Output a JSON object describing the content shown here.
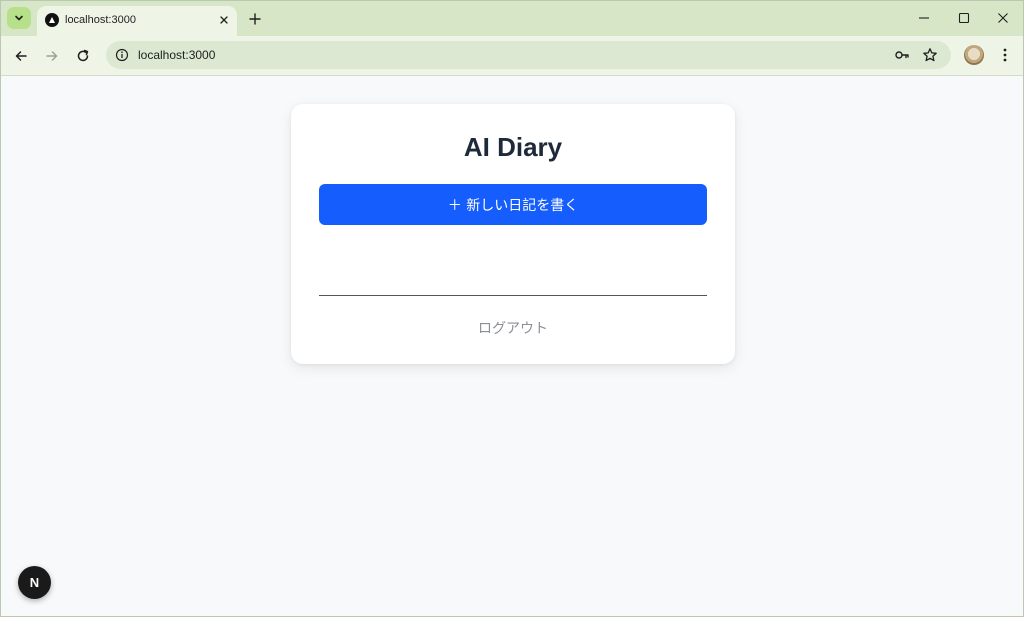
{
  "browser": {
    "tab": {
      "title": "localhost:3000",
      "favicon": "vercel-triangle-icon"
    },
    "address_bar": {
      "url": "localhost:3000"
    },
    "icons": {
      "tab_search": "chevron-down-icon",
      "tab_close": "close-icon",
      "new_tab": "plus-icon",
      "minimize": "minimize-icon",
      "maximize": "maximize-icon",
      "close_window": "close-icon",
      "back": "back-arrow-icon",
      "forward": "forward-arrow-icon",
      "reload": "reload-icon",
      "site_info": "info-icon",
      "passwords": "key-icon",
      "bookmark": "star-icon",
      "menu": "kebab-menu-icon"
    },
    "colors": {
      "tabstrip": "#d6e6c6",
      "toolbar": "#eef5e6",
      "omnibox": "#dce8d2"
    }
  },
  "app": {
    "title": "AI Diary",
    "new_entry_label": "＋ 新しい日記を書く",
    "logout_label": "ログアウト",
    "dev_badge_label": "N",
    "colors": {
      "primary": "#155dfc",
      "title_text": "#1e2939",
      "muted_text": "#8b8f96",
      "background": "#f8f9fb",
      "card": "#ffffff"
    }
  }
}
